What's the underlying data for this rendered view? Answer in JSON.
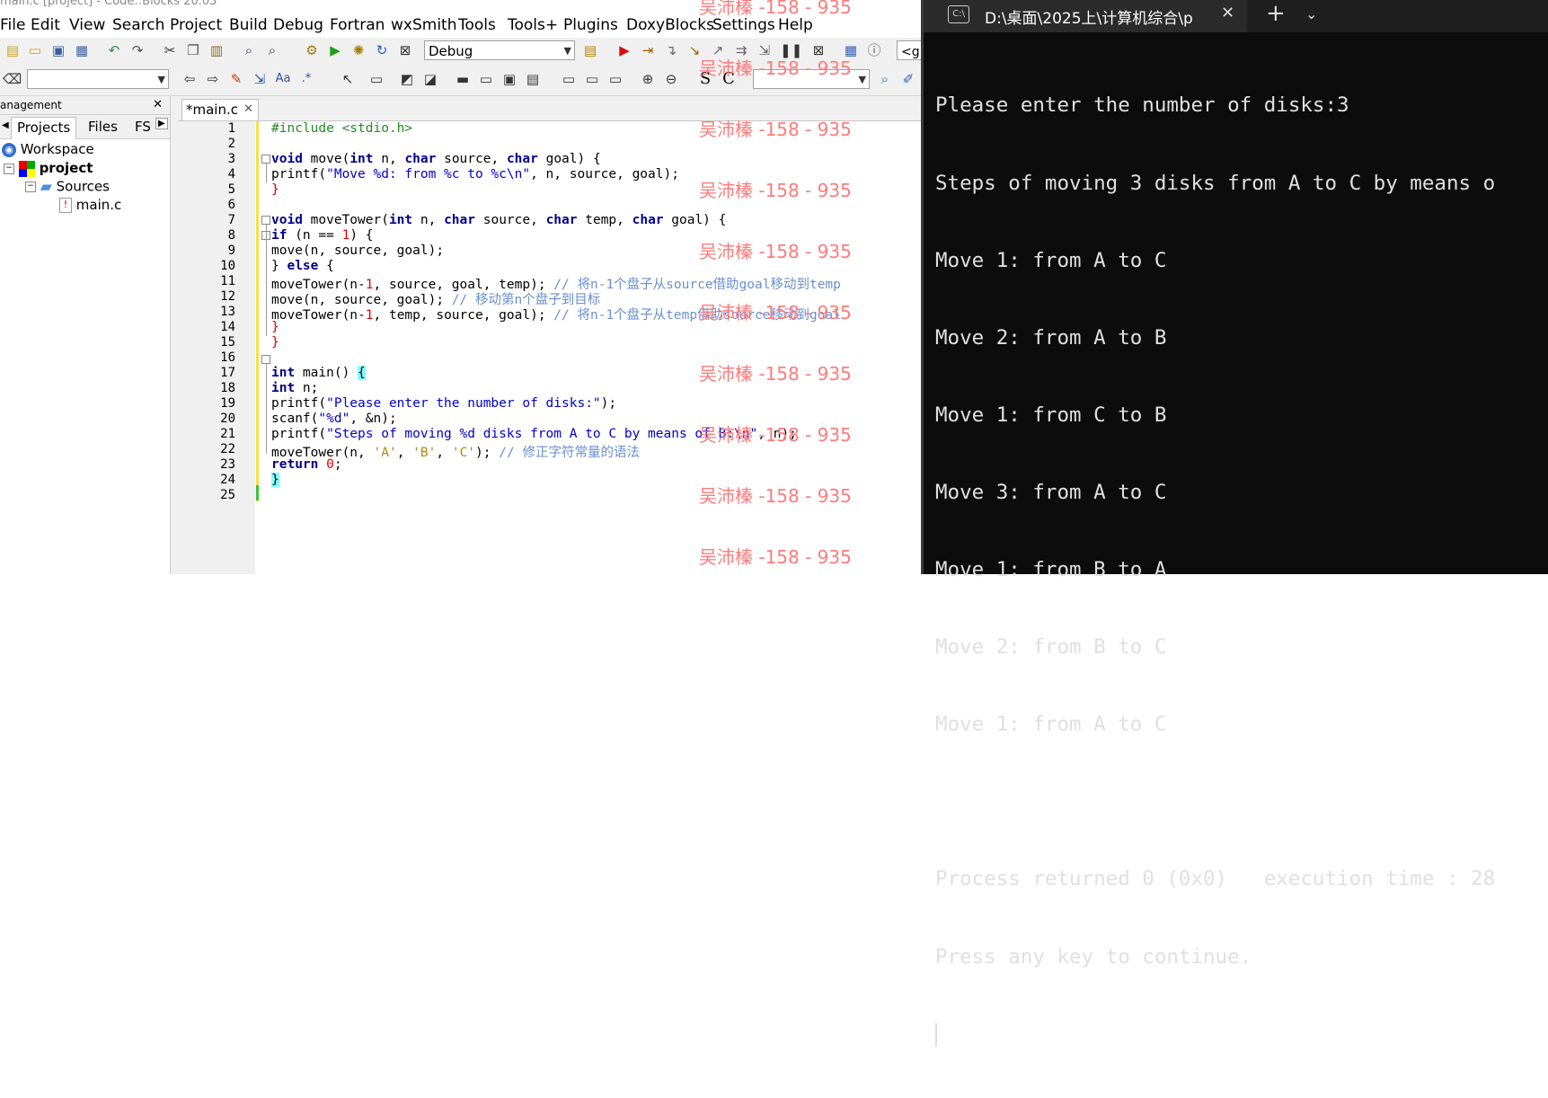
{
  "window_title": "main.c [project] - Code::Blocks 20.03",
  "menu": [
    "File",
    "Edit",
    "View",
    "Search",
    "Project",
    "Build",
    "Debug",
    "Fortran",
    "wxSmith",
    "Tools",
    "Tools+",
    "Plugins",
    "DoxyBlocks",
    "Settings",
    "Help"
  ],
  "build_target": "Debug",
  "toolbar2": {
    "search_combo": "",
    "extra_combo": ""
  },
  "management": {
    "title": "anagement",
    "tabs": [
      "Projects",
      "Files",
      "FS"
    ],
    "tree": {
      "workspace": "Workspace",
      "project": "project",
      "folder": "Sources",
      "file": "main.c"
    }
  },
  "editor": {
    "tab_label": "*main.c",
    "line_numbers": [
      "1",
      "2",
      "3",
      "4",
      "5",
      "6",
      "7",
      "8",
      "9",
      "10",
      "11",
      "12",
      "13",
      "14",
      "15",
      "16",
      "17",
      "18",
      "19",
      "20",
      "21",
      "22",
      "23",
      "24",
      "25"
    ],
    "lines": {
      "l1": "#include <stdio.h>",
      "l3_kw1": "void",
      "l3_a": " move(",
      "l3_kw2": "int",
      "l3_b": " n, ",
      "l3_kw3": "char",
      "l3_c": " source, ",
      "l3_kw4": "char",
      "l3_d": " goal) {",
      "l4_a": "printf(",
      "l4_str": "\"Move %d: from %c to %c\\n\"",
      "l4_b": ", n, source, goal);",
      "l5": "}",
      "l7_kw1": "void",
      "l7_a": " moveTower(",
      "l7_kw2": "int",
      "l7_b": " n, ",
      "l7_kw3": "char",
      "l7_c": " source, ",
      "l7_kw4": "char",
      "l7_d": " temp, ",
      "l7_kw5": "char",
      "l7_e": " goal) {",
      "l8_kw": "if",
      "l8_a": " (n == ",
      "l8_num": "1",
      "l8_b": ") {",
      "l9": "move(n, source, goal);",
      "l10_a": "} ",
      "l10_kw": "else",
      "l10_b": " {",
      "l11_a": "moveTower(n-",
      "l11_num": "1",
      "l11_b": ", source, goal, temp); ",
      "l11_cm": "// 将n-1个盘子从source借助goal移动到temp",
      "l12_a": "move(n, source, goal); ",
      "l12_cm": "// 移动第n个盘子到目标",
      "l13_a": "moveTower(n-",
      "l13_num": "1",
      "l13_b": ", temp, source, goal); ",
      "l13_cm": "// 将n-1个盘子从temp借助source移动到goal",
      "l14": "}",
      "l15": "}",
      "l17_kw": "int",
      "l17_a": " main() ",
      "l17_b": "{",
      "l18_kw": "int",
      "l18_a": " n;",
      "l19_a": "printf(",
      "l19_str": "\"Please enter the number of disks:\"",
      "l19_b": ");",
      "l20_a": "scanf(",
      "l20_str": "\"%d\"",
      "l20_b": ", &n);",
      "l21_a": "printf(",
      "l21_str": "\"Steps of moving %d disks from A to C by means of B:\\n\"",
      "l21_b": ", n);",
      "l22_a": "moveTower(n, ",
      "l22_c1": "'A'",
      "l22_s1": ", ",
      "l22_c2": "'B'",
      "l22_s2": ", ",
      "l22_c3": "'C'",
      "l22_b": "); ",
      "l22_cm": "// 修正字符常量的语法",
      "l23_kw": "return",
      "l23_sp": " ",
      "l23_num": "0",
      "l23_b": ";",
      "l24": "}"
    }
  },
  "watermark": "吴沛榛 -158 - 935",
  "terminal": {
    "tab_title": "D:\\桌面\\2025上\\计算机综合\\p",
    "output": [
      "Please enter the number of disks:3",
      "Steps of moving 3 disks from A to C by means o",
      "Move 1: from A to C",
      "Move 2: from A to B",
      "Move 1: from C to B",
      "Move 3: from A to C",
      "Move 1: from B to A",
      "Move 2: from B to C",
      "Move 1: from A to C",
      "",
      "Process returned 0 (0x0)   execution time : 28",
      "Press any key to continue."
    ]
  },
  "colors": {
    "keyword": "#00008b",
    "string": "#0000cd",
    "comment": "#6a8fd1",
    "number": "#e00000",
    "watermark": "#ff7b7b",
    "terminal_bg": "#0c0c0c"
  }
}
